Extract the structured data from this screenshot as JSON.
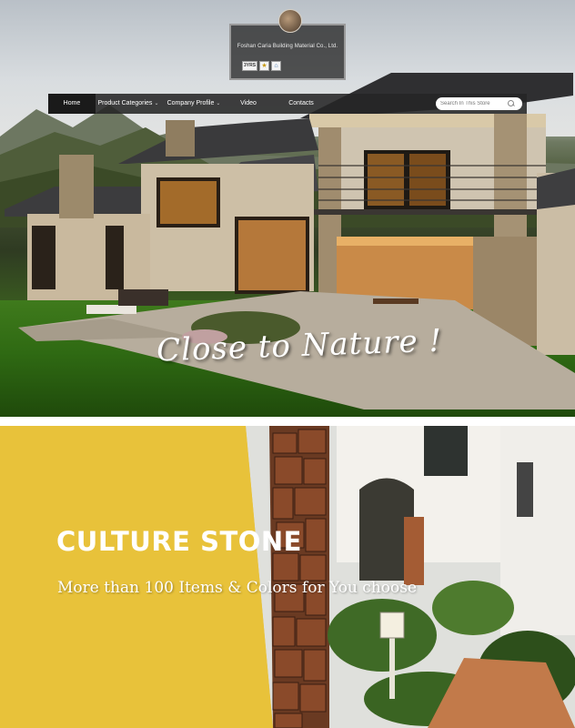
{
  "store": {
    "company_name": "Foshan Caria Building Material Co., Ltd.",
    "years_badge": "3YRS"
  },
  "nav": {
    "items": [
      {
        "label": "Home",
        "active": true
      },
      {
        "label": "Product Categories",
        "has_dropdown": true
      },
      {
        "label": "Company Profile",
        "has_dropdown": true
      },
      {
        "label": "Video"
      },
      {
        "label": "Contacts"
      }
    ],
    "search_placeholder": "Search In This Store"
  },
  "hero": {
    "caption": "Close to Nature !"
  },
  "banner": {
    "title": "CULTURE STONE",
    "subtitle": "More than 100 Items & Colors for You choose"
  },
  "colors": {
    "banner_yellow": "#e8c23a",
    "nav_bg": "#262626"
  }
}
